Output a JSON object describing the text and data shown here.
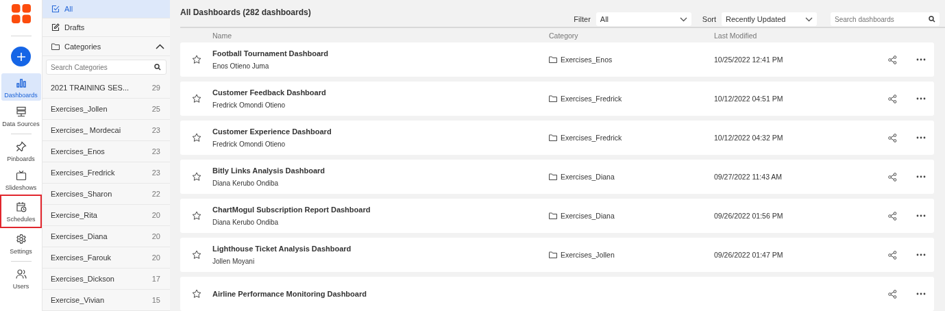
{
  "nav": {
    "items": [
      {
        "kind": "create"
      },
      {
        "kind": "dashboards",
        "label": "Dashboards",
        "selected": true,
        "highlighted": false
      },
      {
        "kind": "datasources",
        "label": "Data Sources",
        "selected": false,
        "highlighted": false
      },
      {
        "kind": "divider"
      },
      {
        "kind": "pinboards",
        "label": "Pinboards",
        "selected": false,
        "highlighted": false
      },
      {
        "kind": "slideshows",
        "label": "Slideshows",
        "selected": false,
        "highlighted": false
      },
      {
        "kind": "schedules",
        "label": "Schedules",
        "selected": false,
        "highlighted": true
      },
      {
        "kind": "settings",
        "label": "Settings",
        "selected": false,
        "highlighted": false
      },
      {
        "kind": "divider"
      },
      {
        "kind": "users",
        "label": "Users",
        "selected": false,
        "highlighted": false
      }
    ]
  },
  "categories_panel": {
    "views": [
      {
        "label": "All",
        "selected": true,
        "kind": "all"
      },
      {
        "label": "Drafts",
        "selected": false,
        "kind": "drafts"
      }
    ],
    "categories_header": {
      "label": "Categories",
      "expanded": true
    },
    "search": {
      "placeholder": "Search Categories"
    },
    "categories": [
      {
        "name": "2021 TRAINING SES...",
        "count": "29"
      },
      {
        "name": "Exercises_Jollen",
        "count": "25"
      },
      {
        "name": "Exercises_ Mordecai",
        "count": "23"
      },
      {
        "name": "Exercises_Enos",
        "count": "23"
      },
      {
        "name": "Exercises_Fredrick",
        "count": "23"
      },
      {
        "name": "Exercises_Sharon",
        "count": "22"
      },
      {
        "name": "Exercise_Rita",
        "count": "20"
      },
      {
        "name": "Exercises_Diana",
        "count": "20"
      },
      {
        "name": "Exercises_Farouk",
        "count": "20"
      },
      {
        "name": "Exercises_Dickson",
        "count": "17"
      },
      {
        "name": "Exercise_Vivian",
        "count": "15"
      }
    ]
  },
  "main": {
    "title": "All Dashboards (282 dashboards)",
    "filter": {
      "label": "Filter",
      "value": "All"
    },
    "sort": {
      "label": "Sort",
      "value": "Recently Updated"
    },
    "search": {
      "placeholder": "Search dashboards"
    },
    "table": {
      "columns": [
        "Name",
        "Category",
        "Last Modified"
      ],
      "rows": [
        {
          "name": "Football Tournament Dashboard",
          "owner": "Enos Otieno Juma",
          "category": "Exercises_Enos",
          "modified": "10/25/2022 12:41 PM",
          "favorite": false
        },
        {
          "name": "Customer Feedback Dashboard",
          "owner": "Fredrick Omondi Otieno",
          "category": "Exercises_Fredrick",
          "modified": "10/12/2022 04:51 PM",
          "favorite": false
        },
        {
          "name": "Customer Experience Dashboard",
          "owner": "Fredrick Omondi Otieno",
          "category": "Exercises_Fredrick",
          "modified": "10/12/2022 04:32 PM",
          "favorite": false
        },
        {
          "name": "Bitly Links Analysis Dashboard",
          "owner": "Diana Kerubo Ondiba",
          "category": "Exercises_Diana",
          "modified": "09/27/2022 11:43 AM",
          "favorite": false
        },
        {
          "name": "ChartMogul Subscription Report Dashboard",
          "owner": "Diana Kerubo Ondiba",
          "category": "Exercises_Diana",
          "modified": "09/26/2022 01:56 PM",
          "favorite": false
        },
        {
          "name": "Lighthouse Ticket Analysis Dashboard",
          "owner": "Jollen Moyani",
          "category": "Exercises_Jollen",
          "modified": "09/26/2022 01:47 PM",
          "favorite": false
        },
        {
          "name": "Airline Performance Monitoring Dashboard",
          "favorite": false
        }
      ]
    }
  }
}
